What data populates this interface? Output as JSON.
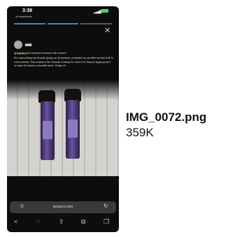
{
  "status_bar": {
    "time": "3:38",
    "back_app": "◂ Instashields"
  },
  "review": {
    "title": "★★★★★ Ultra hardened meramic with ceramic",
    "body": "So I was putting my ceramic glossy on all surfaces, protected my car after my fast is all in a few months. This is what is the Ceramic Coating I'm used it for. Easy to apply spray it on wipe off, leaves a beautiful shine. Really. A+"
  },
  "browser": {
    "aa": "⅁",
    "url": "amazon.com",
    "reload": "↻"
  },
  "toolbar": {
    "back": "<",
    "forward": ">",
    "share": "⇧",
    "bookmarks": "⧉",
    "tabs": "❐"
  },
  "file": {
    "name": "IMG_0072.png",
    "size": "359K"
  }
}
